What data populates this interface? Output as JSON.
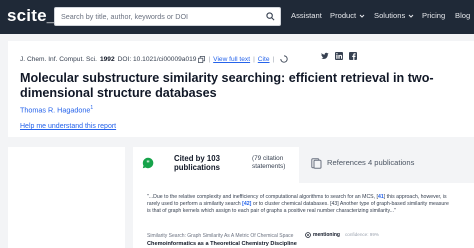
{
  "nav": {
    "logo": "scite_",
    "search_placeholder": "Search by title, author, keywords or DOI",
    "items": [
      {
        "label": "Assistant"
      },
      {
        "label": "Product"
      },
      {
        "label": "Solutions"
      },
      {
        "label": "Pricing"
      },
      {
        "label": "Blog"
      }
    ]
  },
  "paper": {
    "journal": "J. Chem. Inf. Comput. Sci.",
    "year": "1992",
    "doi": "DOI: 10.1021/ci00009a019",
    "view_full_text": "View full text",
    "cite": "Cite",
    "title": "Molecular substructure similarity searching: efficient retrieval in two-dimensional structure databases",
    "author": "Thomas R. Hagadone",
    "author_sup": "1",
    "help_link": "Help me understand this report"
  },
  "citations": {
    "cited_by": "Cited by 103 publications",
    "statements": "(79 citation statements)",
    "references": "References 4 publications",
    "excerpt_prefix": "\"...Due to the relative complexity and inefficiency of computational algorithms to search for an MCS, [",
    "excerpt_ref1": "41",
    "excerpt_mid": "] this approach, however, is rarely used to perform a similarity search ",
    "excerpt_ref2": "[42]",
    "excerpt_suffix": " or to cluster chemical databases. [43] Another type of graph-based similarity measure is that of graph kernels which assign to each pair of graphs a positive real number characterizing similarity...\"",
    "source": "Similarity Search: Graph Similarity As A Metric Of Chemical Space",
    "mention_label": "mentioning",
    "confidence": "confidence: 99%",
    "next_source": "Chemoinformatics as a Theoretical Chemistry Discipline"
  },
  "colors": {
    "nav_bg": "#1f2937",
    "link": "#2563eb",
    "page_bg": "#f3f4f6",
    "quote_icon": "#16a34a"
  }
}
